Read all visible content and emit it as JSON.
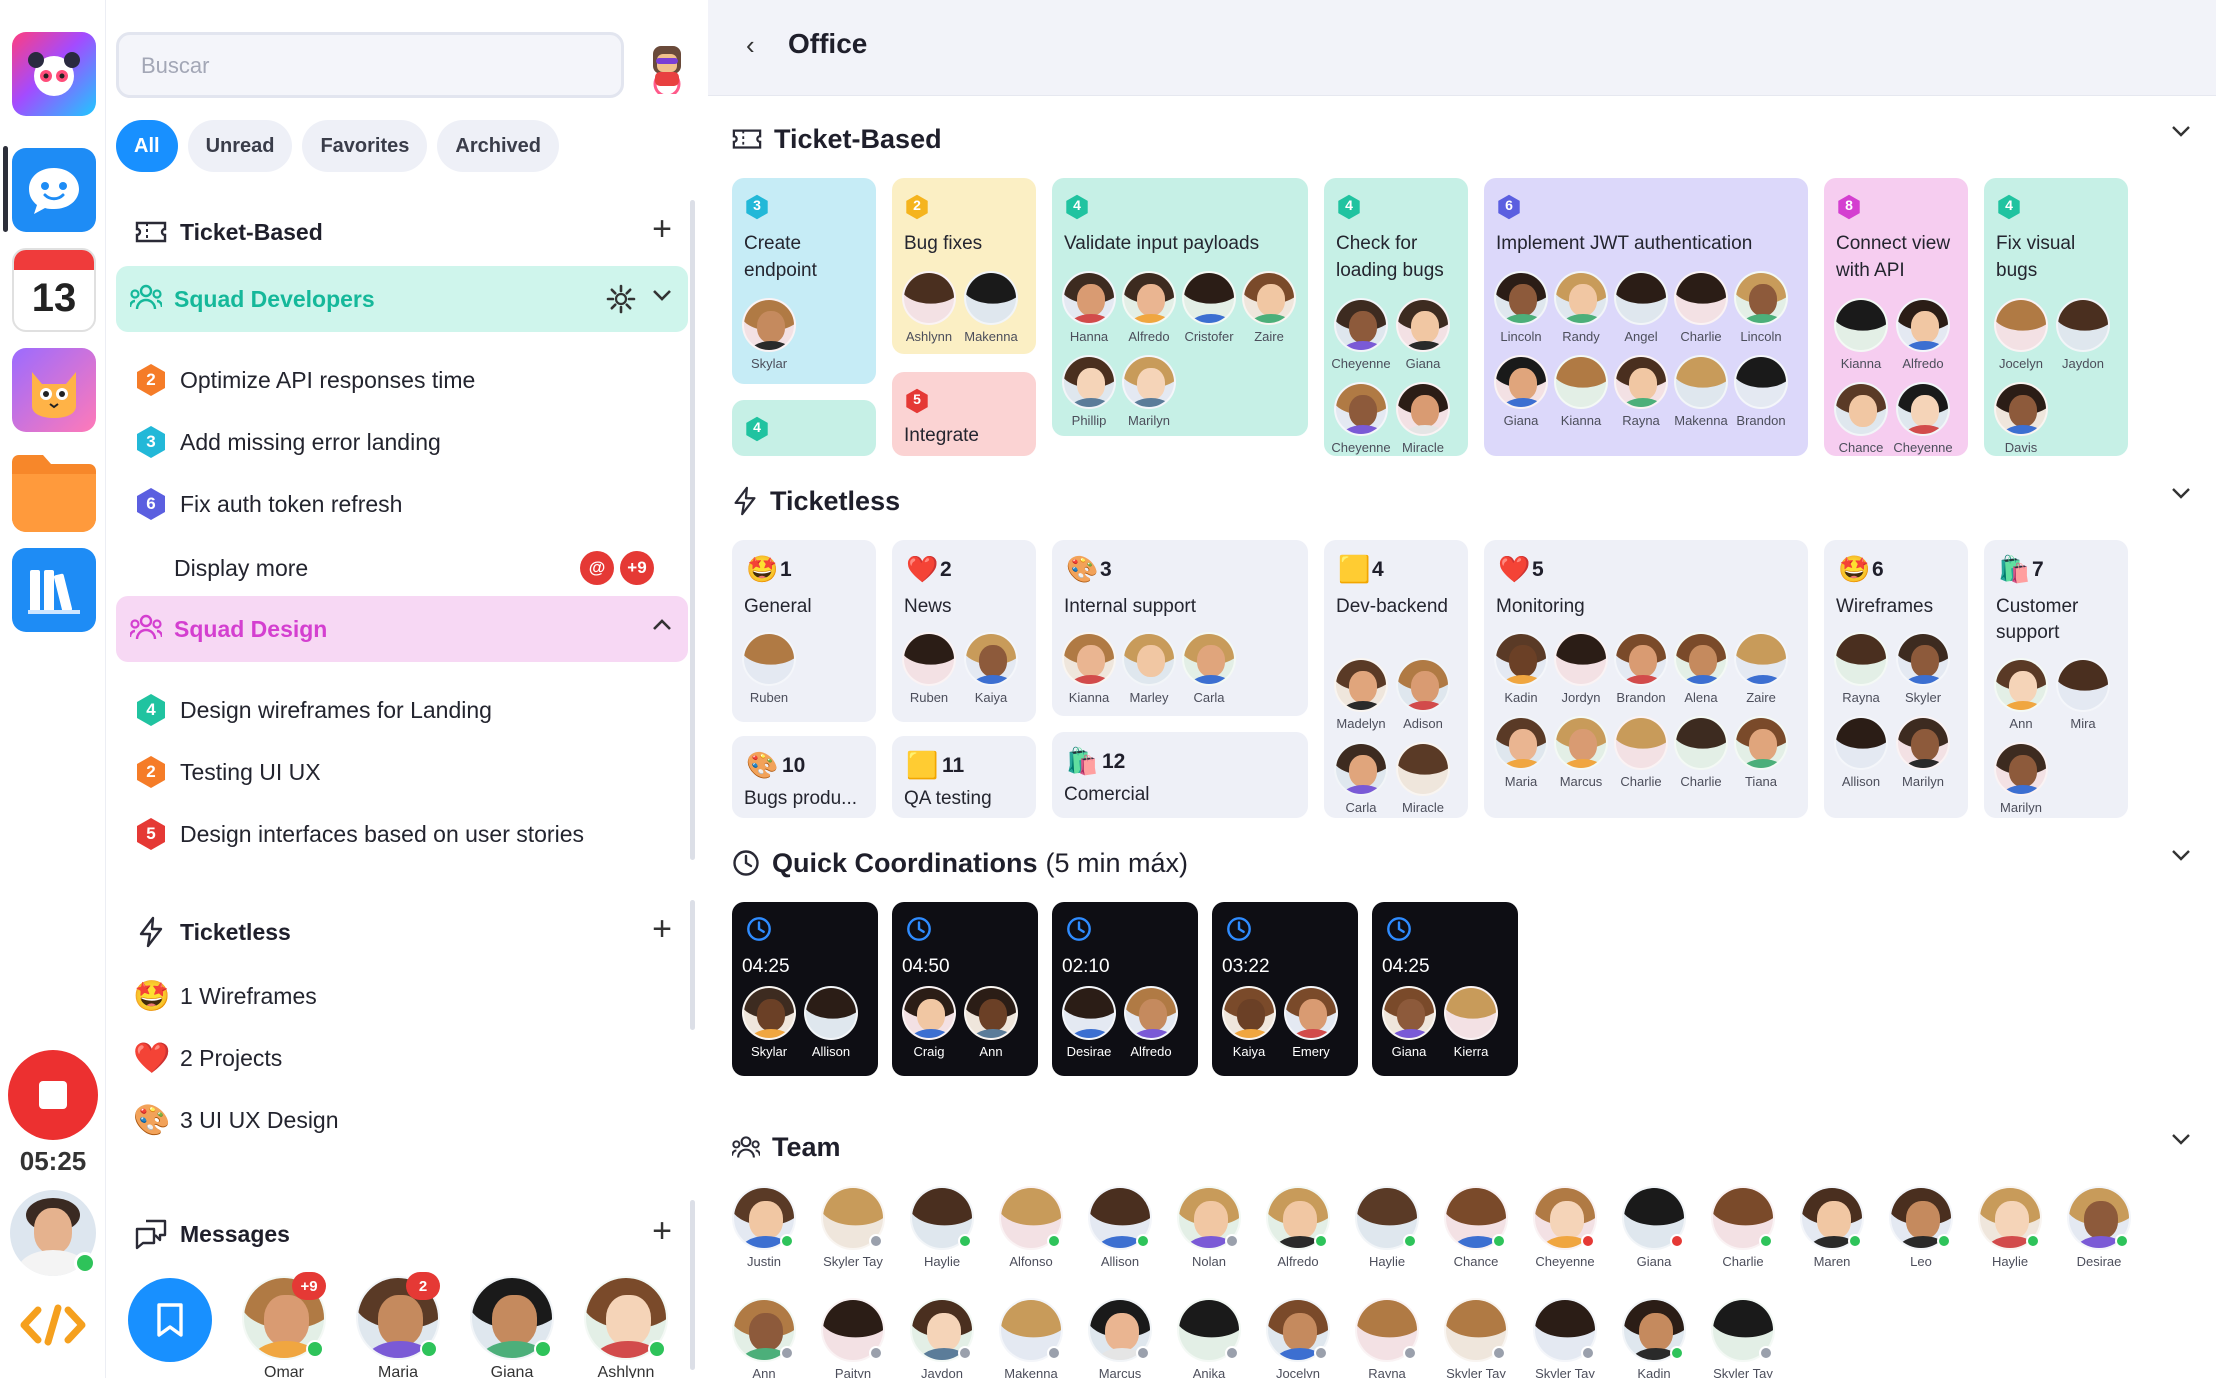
{
  "sidebar": {
    "search_placeholder": "Buscar",
    "filters": [
      "All",
      "Unread",
      "Favorites",
      "Archived"
    ],
    "ticket_based": {
      "title": "Ticket-Based",
      "squad_developers": {
        "label": "Squad Developers",
        "items": [
          {
            "n": "2",
            "label": "Optimize API responses time",
            "color": "#f57c28"
          },
          {
            "n": "3",
            "label": "Add missing error landing",
            "color": "#22b8d8"
          },
          {
            "n": "6",
            "label": "Fix auth token refresh",
            "color": "#5b5fe0"
          }
        ],
        "more": "Display more",
        "mention": "@",
        "more_count": "+9"
      },
      "squad_design": {
        "label": "Squad Design",
        "items": [
          {
            "n": "4",
            "label": "Design wireframes for Landing",
            "color": "#20c3a0"
          },
          {
            "n": "2",
            "label": "Testing UI UX",
            "color": "#f57c28"
          },
          {
            "n": "5",
            "label": "Design interfaces based on user stories",
            "color": "#e53935"
          }
        ]
      }
    },
    "ticketless": {
      "title": "Ticketless",
      "items": [
        {
          "emoji": "🤩",
          "label": "1 Wireframes"
        },
        {
          "emoji": "❤️",
          "label": "2 Projects"
        },
        {
          "emoji": "🎨",
          "label": "3 UI UX Design"
        }
      ]
    },
    "messages": {
      "title": "Messages",
      "contacts": [
        {
          "name": "Omar",
          "badge": "+9"
        },
        {
          "name": "Maria",
          "badge": "2"
        },
        {
          "name": "Giana",
          "badge": ""
        },
        {
          "name": "Ashlynn",
          "badge": ""
        }
      ]
    },
    "timer": "05:25"
  },
  "main": {
    "title": "Office",
    "ticket_based_title": "Ticket-Based",
    "ticketless_title": "Ticketless",
    "quick_title": "Quick Coordinations",
    "quick_sub": "(5 min máx)",
    "team_title": "Team",
    "ticket_cards": [
      {
        "n": "3",
        "title": "Create endpoint",
        "people": [
          "Skylar"
        ]
      },
      {
        "n": "2",
        "title": "Bug fixes",
        "people": [
          "Ashlynn",
          "Makenna"
        ]
      },
      {
        "n": "4",
        "title": "Validate input payloads",
        "people": [
          "Hanna",
          "Alfredo",
          "Cristofer",
          "Zaire",
          "Phillip",
          "Marilyn"
        ]
      },
      {
        "n": "4",
        "title": "Check for loading bugs",
        "people": [
          "Cheyenne",
          "Giana",
          "Cheyenne",
          "Miracle"
        ]
      },
      {
        "n": "6",
        "title": "Implement JWT authentication",
        "people": [
          "Lincoln",
          "Randy",
          "Angel",
          "Charlie",
          "Lincoln",
          "Giana",
          "Kianna",
          "Rayna",
          "Makenna",
          "Brandon"
        ]
      },
      {
        "n": "8",
        "title": "Connect view with API",
        "people": [
          "Kianna",
          "Alfredo",
          "Chance",
          "Cheyenne"
        ]
      },
      {
        "n": "4",
        "title": "Fix visual bugs",
        "people": [
          "Jocelyn",
          "Jaydon",
          "Davis"
        ]
      },
      {
        "n": "4",
        "title": "",
        "people": []
      },
      {
        "n": "5",
        "title": "Integrate",
        "people": []
      }
    ],
    "ticketless_cards": [
      {
        "emoji": "🤩",
        "n": "1",
        "name": "General",
        "people": [
          "Ruben"
        ]
      },
      {
        "emoji": "❤️",
        "n": "2",
        "name": "News",
        "people": [
          "Ruben",
          "Kaiya"
        ]
      },
      {
        "emoji": "🎨",
        "n": "3",
        "name": "Internal support",
        "people": [
          "Kianna",
          "Marley",
          "Carla"
        ]
      },
      {
        "emoji": "🟨",
        "n": "4",
        "name": "Dev-backend",
        "people": [
          "Madelyn",
          "Adison",
          "Carla",
          "Miracle"
        ]
      },
      {
        "emoji": "❤️",
        "n": "5",
        "name": "Monitoring",
        "people": [
          "Kadin",
          "Jordyn",
          "Brandon",
          "Alena",
          "Zaire",
          "Maria",
          "Marcus",
          "Charlie",
          "Charlie",
          "Tiana"
        ]
      },
      {
        "emoji": "🤩",
        "n": "6",
        "name": "Wireframes",
        "people": [
          "Rayna",
          "Skyler",
          "Allison",
          "Marilyn"
        ]
      },
      {
        "emoji": "🛍️",
        "n": "7",
        "name": "Customer support",
        "people": [
          "Ann",
          "Mira",
          "Marilyn"
        ]
      },
      {
        "emoji": "🎨",
        "n": "10",
        "name": "Bugs produ...",
        "people": []
      },
      {
        "emoji": "🟨",
        "n": "11",
        "name": "QA testing",
        "people": []
      },
      {
        "emoji": "🛍️",
        "n": "12",
        "name": "Comercial",
        "people": []
      }
    ],
    "quick": [
      {
        "time": "04:25",
        "people": [
          "Skylar",
          "Allison"
        ]
      },
      {
        "time": "04:50",
        "people": [
          "Craig",
          "Ann"
        ]
      },
      {
        "time": "02:10",
        "people": [
          "Desirae",
          "Alfredo"
        ]
      },
      {
        "time": "03:22",
        "people": [
          "Kaiya",
          "Emery"
        ]
      },
      {
        "time": "04:25",
        "people": [
          "Giana",
          "Kierra"
        ]
      }
    ],
    "team": [
      {
        "name": "Justin",
        "status": "green"
      },
      {
        "name": "Skyler Tay",
        "status": "gray"
      },
      {
        "name": "Haylie",
        "status": "green"
      },
      {
        "name": "Alfonso",
        "status": "green"
      },
      {
        "name": "Allison",
        "status": "green"
      },
      {
        "name": "Nolan",
        "status": "gray"
      },
      {
        "name": "Alfredo",
        "status": "green"
      },
      {
        "name": "Haylie",
        "status": "green"
      },
      {
        "name": "Chance",
        "status": "green"
      },
      {
        "name": "Cheyenne",
        "status": "red"
      },
      {
        "name": "Giana",
        "status": "red"
      },
      {
        "name": "Charlie",
        "status": "green"
      },
      {
        "name": "Maren",
        "status": "green"
      },
      {
        "name": "Leo",
        "status": "green"
      },
      {
        "name": "Haylie",
        "status": "green"
      },
      {
        "name": "Desirae",
        "status": "green"
      },
      {
        "name": "Ann",
        "status": "gray"
      },
      {
        "name": "Paityn",
        "status": "gray"
      },
      {
        "name": "Jaydon",
        "status": "gray"
      },
      {
        "name": "Makenna",
        "status": "gray"
      },
      {
        "name": "Marcus",
        "status": "gray"
      },
      {
        "name": "Anika",
        "status": "gray"
      },
      {
        "name": "Jocelyn",
        "status": "gray"
      },
      {
        "name": "Rayna",
        "status": "gray"
      },
      {
        "name": "Skyler Tay",
        "status": "gray"
      },
      {
        "name": "Skyler Tay",
        "status": "gray"
      },
      {
        "name": "Kadin",
        "status": "green"
      },
      {
        "name": "Skyler Tay",
        "status": "gray"
      }
    ]
  }
}
